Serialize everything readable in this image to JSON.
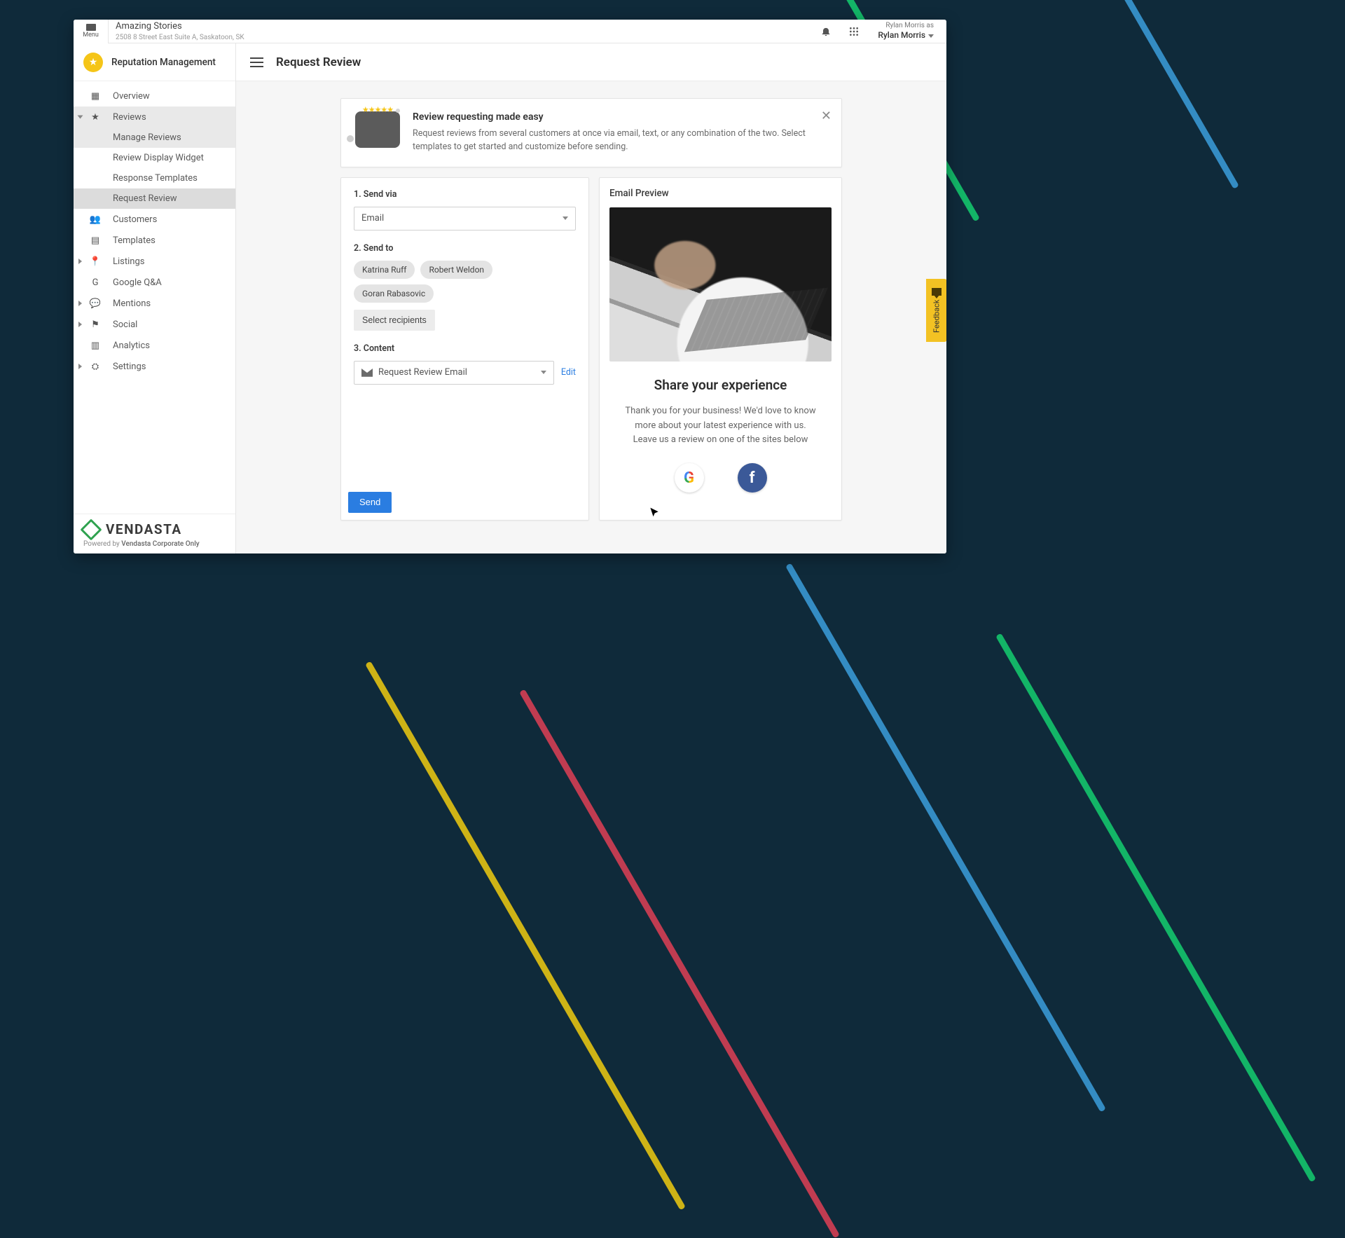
{
  "topbar": {
    "menu_label": "Menu",
    "business_name": "Amazing Stories",
    "business_address": "2508 8 Street East Suite A, Saskatoon, SK",
    "user_as_label": "Rylan Morris as",
    "user_name": "Rylan Morris"
  },
  "sidebar": {
    "product_name": "Reputation Management",
    "items": {
      "overview": "Overview",
      "reviews": "Reviews",
      "manage_reviews": "Manage Reviews",
      "review_display_widget": "Review Display Widget",
      "response_templates": "Response Templates",
      "request_review": "Request Review",
      "customers": "Customers",
      "templates": "Templates",
      "listings": "Listings",
      "google_qa": "Google Q&A",
      "mentions": "Mentions",
      "social": "Social",
      "analytics": "Analytics",
      "settings": "Settings"
    },
    "brand": "VENDASTA",
    "powered_prefix": "Powered by ",
    "powered_name": "Vendasta Corporate Only"
  },
  "page": {
    "title": "Request Review"
  },
  "intro": {
    "title": "Review requesting made easy",
    "body": "Request reviews from several customers at once via email, text, or any combination of the two. Select templates to get started and customize before sending."
  },
  "form": {
    "step1_label": "1. Send via",
    "send_via_value": "Email",
    "step2_label": "2. Send to",
    "recipients": [
      "Katrina Ruff",
      "Robert Weldon",
      "Goran Rabasovic"
    ],
    "select_recipients_label": "Select recipients",
    "step3_label": "3. Content",
    "content_value": "Request Review Email",
    "edit_label": "Edit",
    "send_label": "Send"
  },
  "preview": {
    "panel_title": "Email Preview",
    "heading": "Share your experience",
    "body": "Thank you for your business! We'd love to know more about your latest experience with us. Leave us a review on one of the sites below"
  },
  "feedback_tab": "Feedback"
}
